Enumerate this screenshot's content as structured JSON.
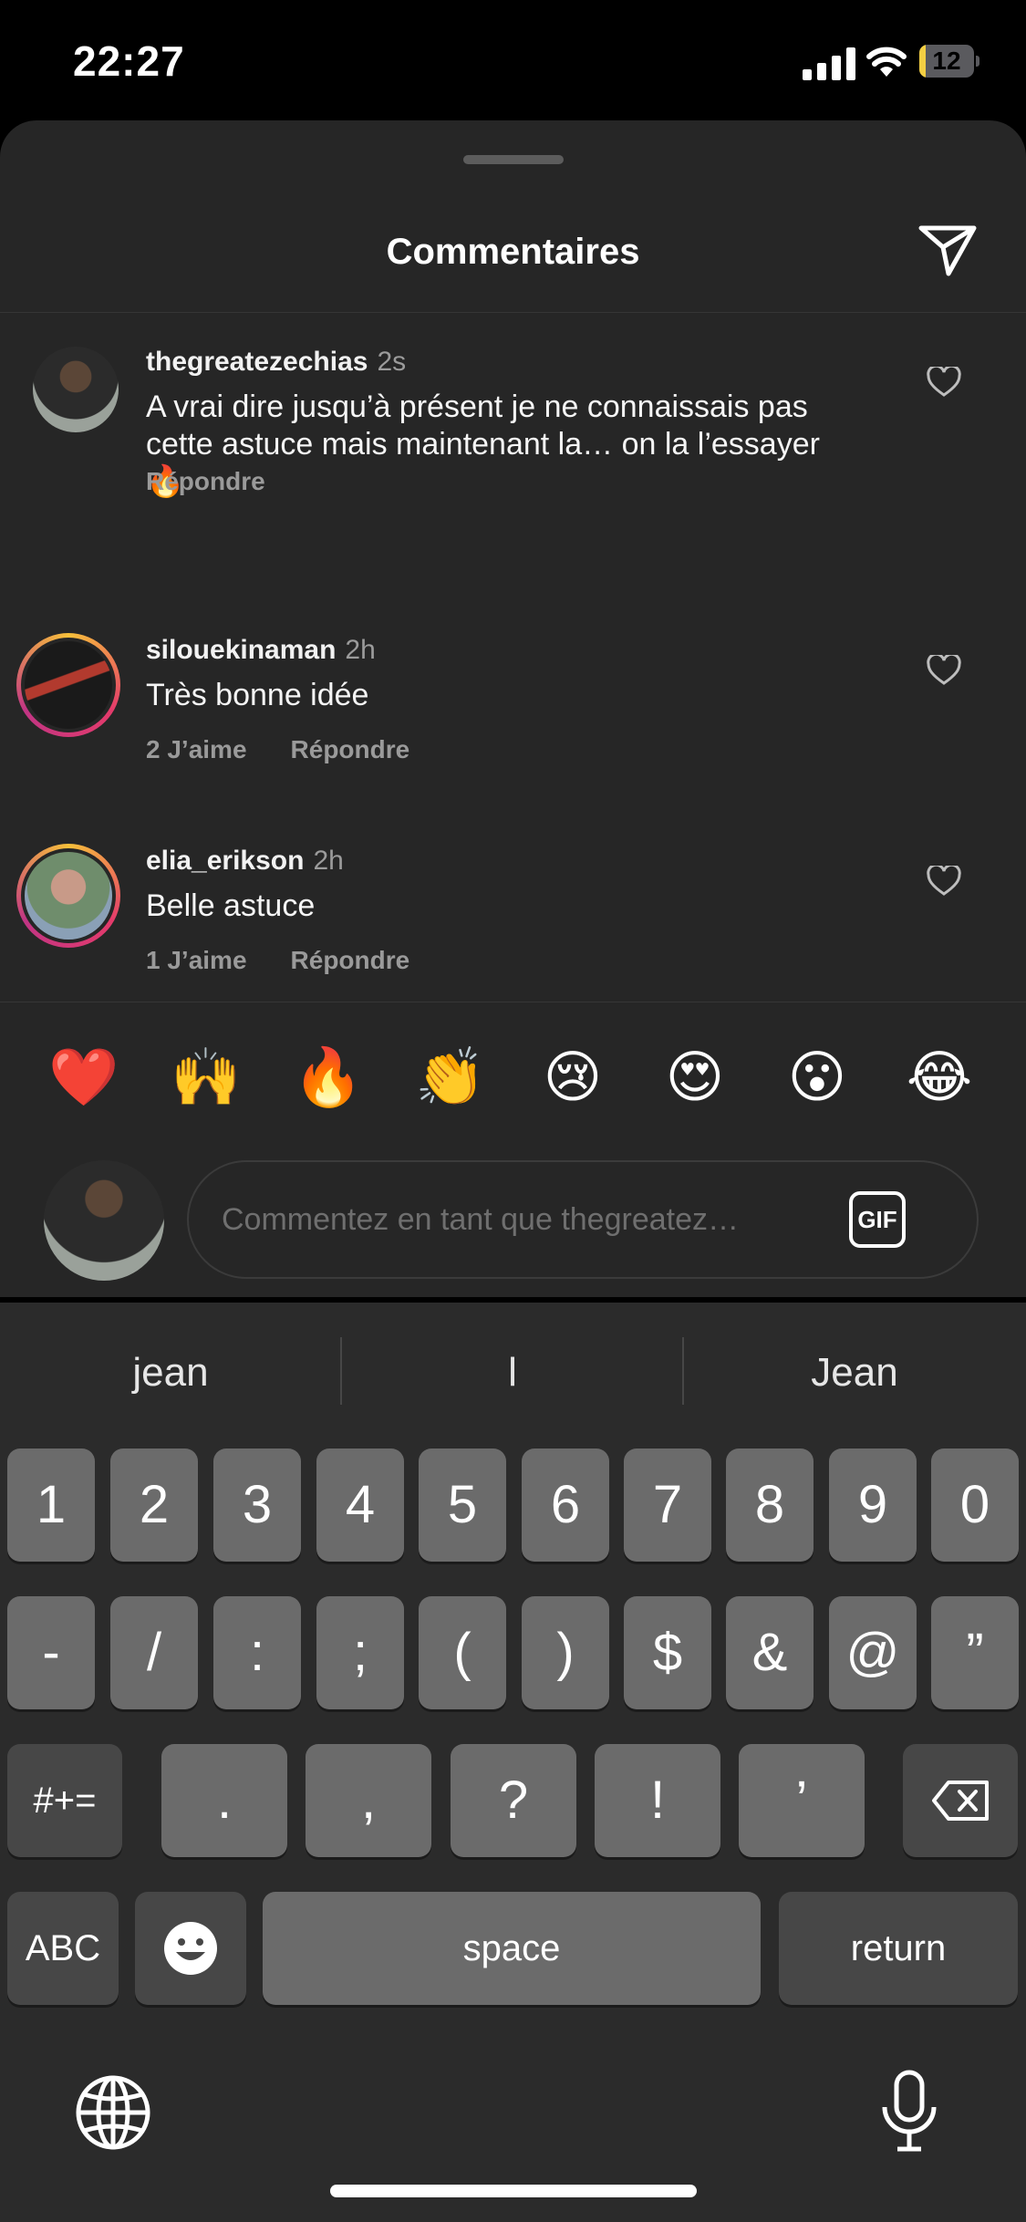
{
  "status_bar": {
    "time": "22:27",
    "battery": "12",
    "battery_level": 0.12,
    "battery_color": "#f4cf43"
  },
  "sheet": {
    "title": "Commentaires"
  },
  "comments": [
    {
      "username": "thegreatezechias",
      "time_ago": "2s",
      "text": "A vrai dire jusqu’à présent je ne connaissais pas cette astuce mais maintenant la… on la l’essayer 🔥",
      "likes": "",
      "reply": "Répondre"
    },
    {
      "username": "silouekinaman",
      "time_ago": "2h",
      "text": "Très bonne idée",
      "likes": "2 J’aime",
      "reply": "Répondre"
    },
    {
      "username": "elia_erikson",
      "time_ago": "2h",
      "text": "Belle astuce",
      "likes": "1 J’aime",
      "reply": "Répondre"
    }
  ],
  "quick_reactions": [
    "❤️",
    "🙌",
    "🔥",
    "👏",
    "😢",
    "😍",
    "😮",
    "😂"
  ],
  "comment_input": {
    "placeholder": "Commentez en tant que thegreatez…",
    "gif_label": "GIF"
  },
  "keyboard": {
    "suggestions": [
      "jean",
      "l",
      "Jean"
    ],
    "row1": [
      "1",
      "2",
      "3",
      "4",
      "5",
      "6",
      "7",
      "8",
      "9",
      "0"
    ],
    "row2": [
      "-",
      "/",
      ":",
      ";",
      "(",
      ")",
      "$",
      "&",
      "@",
      "”"
    ],
    "row3_toggle": "#+=",
    "row3": [
      ".",
      ",",
      "?",
      "!",
      "’"
    ],
    "abc": "ABC",
    "space": "space",
    "return": "return"
  },
  "colors": {
    "background": "#262626",
    "keyboard": "#2b2b2b",
    "key": "#6b6b6b",
    "key_dark": "#474747",
    "story_ring": "#c13584"
  }
}
